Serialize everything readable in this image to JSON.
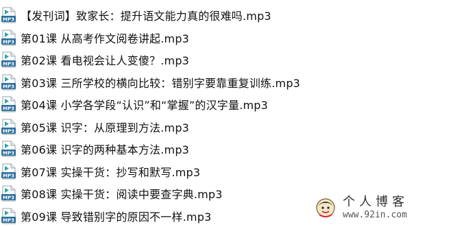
{
  "files": [
    {
      "name": "【发刊词】致家长：提升语文能力真的很难吗.mp3",
      "icon": "mp3-file-icon"
    },
    {
      "name": "第01课 从高考作文阅卷讲起.mp3",
      "icon": "mp3-file-icon"
    },
    {
      "name": "第02课 看电视会让人变傻？.mp3",
      "icon": "mp3-file-icon"
    },
    {
      "name": "第03课 三所学校的横向比较：错别字要靠重复训练.mp3",
      "icon": "mp3-file-icon"
    },
    {
      "name": "第04课 小学各学段“认识”和“掌握”的汉字量.mp3",
      "icon": "mp3-file-icon"
    },
    {
      "name": "第05课 识字：从原理到方法.mp3",
      "icon": "mp3-file-icon"
    },
    {
      "name": "第06课 识字的两种基本方法.mp3",
      "icon": "mp3-file-icon"
    },
    {
      "name": "第07课 实操干货：抄写和默写.mp3",
      "icon": "mp3-file-icon"
    },
    {
      "name": "第08课 实操干货：阅读中要查字典.mp3",
      "icon": "mp3-file-icon"
    },
    {
      "name": "第09课 导致错别字的原因不一样.mp3",
      "icon": "mp3-file-icon"
    }
  ],
  "watermark": {
    "title": "个人博客",
    "url": "www.92in.com"
  },
  "colors": {
    "icon_teal": "#2aa7a1",
    "icon_label": "#2b6f9e"
  }
}
